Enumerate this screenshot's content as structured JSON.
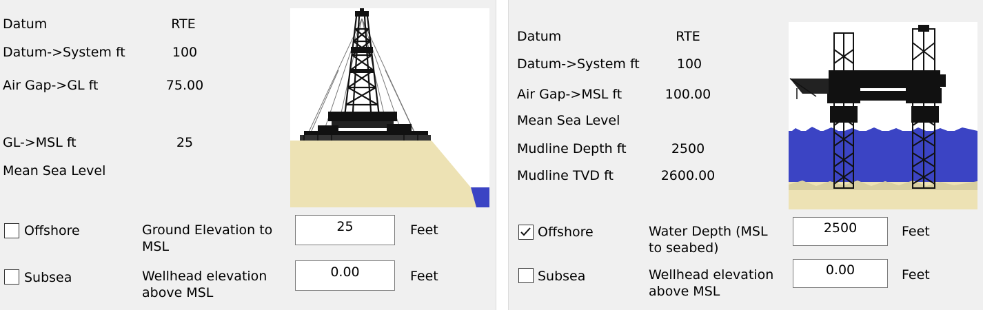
{
  "left": {
    "datum_label": "Datum",
    "datum_value": "RTE",
    "datum_system_label": "Datum->System ft",
    "datum_system_value": "100",
    "airgap_label": "Air Gap->GL ft",
    "airgap_value": "75.00",
    "gl_msl_label": "GL->MSL ft",
    "gl_msl_value": "25",
    "msl_label": "Mean Sea Level",
    "offshore_label": "Offshore",
    "offshore_checked": false,
    "subsea_label": "Subsea",
    "subsea_checked": false,
    "elevation_label": "Ground Elevation to MSL",
    "elevation_value": "25",
    "elevation_unit": "Feet",
    "wellhead_label": "Wellhead elevation above MSL",
    "wellhead_value": "0.00",
    "wellhead_unit": "Feet",
    "image_icon": "land-drilling-rig-icon"
  },
  "right": {
    "datum_label": "Datum",
    "datum_value": "RTE",
    "datum_system_label": "Datum->System ft",
    "datum_system_value": "100",
    "airgap_label": "Air Gap->MSL ft",
    "airgap_value": "100.00",
    "msl_label": "Mean Sea Level",
    "mudline_depth_label": "Mudline Depth ft",
    "mudline_depth_value": "2500",
    "mudline_tvd_label": "Mudline TVD ft",
    "mudline_tvd_value": "2600.00",
    "offshore_label": "Offshore",
    "offshore_checked": true,
    "subsea_label": "Subsea",
    "subsea_checked": false,
    "water_depth_label": "Water Depth (MSL to seabed)",
    "water_depth_value": "2500",
    "water_depth_unit": "Feet",
    "wellhead_label": "Wellhead elevation above MSL",
    "wellhead_value": "0.00",
    "wellhead_unit": "Feet",
    "image_icon": "offshore-jackup-rig-icon"
  },
  "colors": {
    "panel_bg": "#f0f0f0",
    "sand": "#ede2b4",
    "water": "#3b44c4",
    "rig": "#111111"
  }
}
